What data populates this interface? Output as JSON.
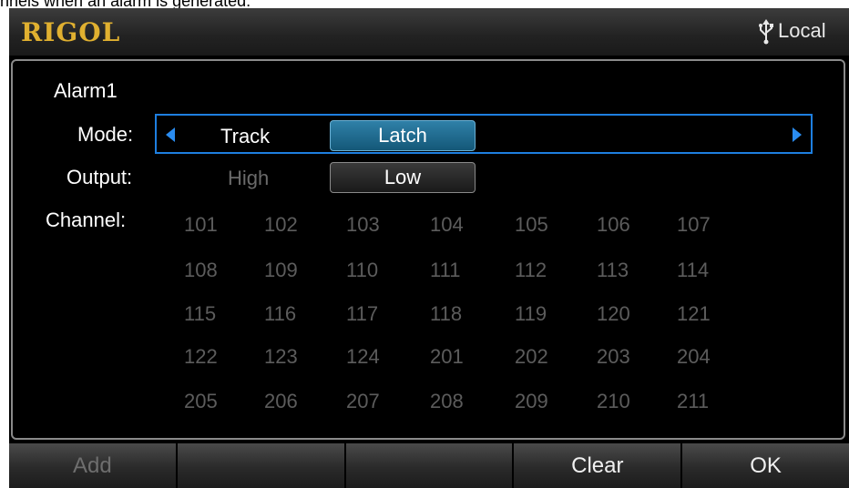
{
  "caption": "nnels when an alarm is generated.",
  "titlebar": {
    "logo": "RIGOL",
    "usb_icon": "usb-icon",
    "status": "Local"
  },
  "alarm": {
    "title": "Alarm1"
  },
  "mode": {
    "label": "Mode:",
    "options": [
      "Track",
      "Latch"
    ],
    "selected": "Latch"
  },
  "output": {
    "label": "Output:",
    "options": [
      "High",
      "Low"
    ],
    "selected": "Low"
  },
  "channel": {
    "label": "Channel:",
    "rows": [
      [
        "101",
        "102",
        "103",
        "104",
        "105",
        "106",
        "107"
      ],
      [
        "108",
        "109",
        "110",
        "111",
        "112",
        "113",
        "114"
      ],
      [
        "115",
        "116",
        "117",
        "118",
        "119",
        "120",
        "121"
      ],
      [
        "122",
        "123",
        "124",
        "201",
        "202",
        "203",
        "204"
      ],
      [
        "205",
        "206",
        "207",
        "208",
        "209",
        "210",
        "211"
      ]
    ]
  },
  "softkeys": [
    {
      "label": "Add",
      "enabled": false
    },
    {
      "label": "",
      "enabled": false
    },
    {
      "label": "",
      "enabled": false
    },
    {
      "label": "Clear",
      "enabled": true
    },
    {
      "label": "OK",
      "enabled": true
    }
  ],
  "colors": {
    "accent": "#1e7fe0",
    "logo": "#e0b030",
    "selected_button": "#1f6a8e",
    "disabled_text": "#5c5c5c"
  }
}
